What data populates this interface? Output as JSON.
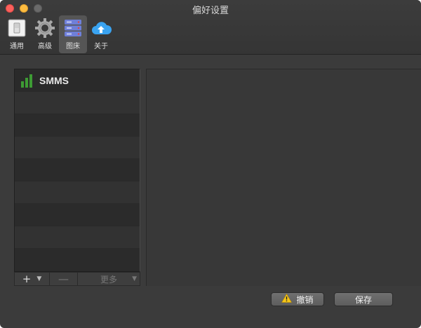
{
  "window": {
    "title": "偏好设置"
  },
  "toolbar": {
    "items": [
      {
        "label": "通用",
        "icon": "switch-icon"
      },
      {
        "label": "高级",
        "icon": "gear-icon"
      },
      {
        "label": "图床",
        "icon": "server-icon",
        "active": true
      },
      {
        "label": "关于",
        "icon": "cloud-upload-icon"
      }
    ]
  },
  "uploaders": {
    "items": [
      {
        "name": "SMMS",
        "icon": "signal-bars-icon"
      }
    ]
  },
  "list_footer": {
    "add_label": "+",
    "remove_label": "—",
    "more_label": "更多"
  },
  "actions": {
    "cancel_label": "撤销",
    "save_label": "保存"
  },
  "colors": {
    "window_bg": "#3b3b3b",
    "signal_green": "#3d9b34",
    "button": "#6a6a6a"
  }
}
